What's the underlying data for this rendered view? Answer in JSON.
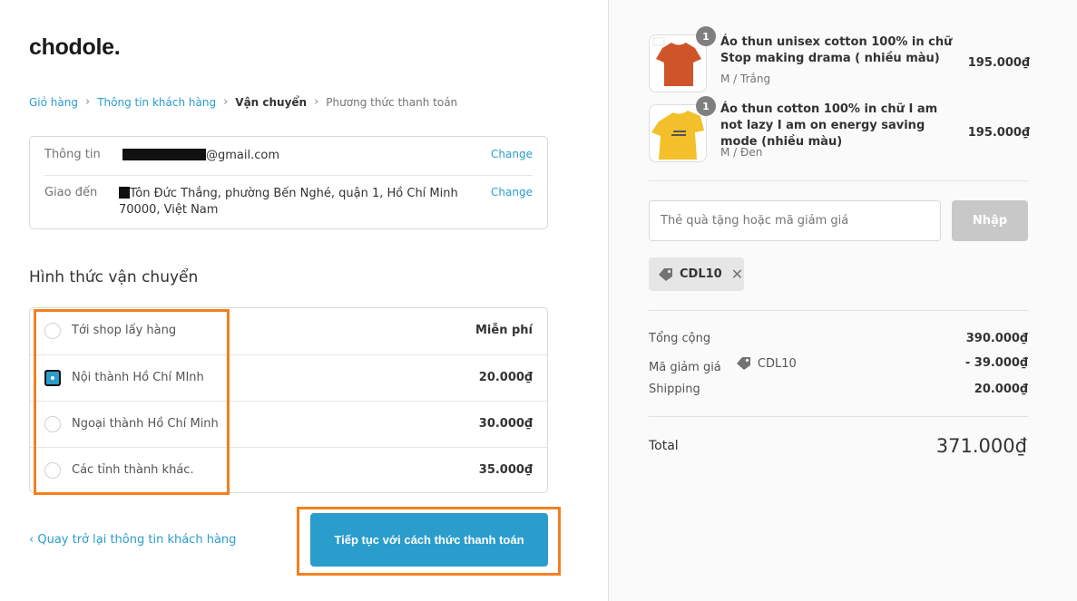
{
  "brand": "chodole.",
  "breadcrumb": {
    "cart": "Giỏ hàng",
    "customer_info": "Thông tin khách hàng",
    "shipping": "Vận chuyển",
    "payment": "Phương thức thanh toán"
  },
  "info": {
    "contact_label": "Thông tin",
    "contact_value": "@gmail.com",
    "ship_to_label": "Giao đến",
    "ship_to_value": "Tôn Đức Thắng, phường Bến Nghé, quận 1, Hồ Chí Minh 70000, Việt Nam",
    "change_label": "Change"
  },
  "shipping": {
    "title": "Hình thức vận chuyển",
    "options": [
      {
        "name": "Tới shop lấy hàng",
        "price": "Miễn phí",
        "selected": false
      },
      {
        "name": "Nội thành Hồ Chí MInh",
        "price": "20.000₫",
        "selected": true
      },
      {
        "name": "Ngoại thành Hồ Chí Minh",
        "price": "30.000₫",
        "selected": false
      },
      {
        "name": "Các tỉnh thành khác.",
        "price": "35.000₫",
        "selected": false
      }
    ]
  },
  "nav": {
    "back": "Quay trở lại thông tin khách hàng",
    "continue": "Tiếp tục với cách thức thanh toán"
  },
  "products": [
    {
      "quantity": "1",
      "name": "Áo thun unisex cotton 100% in chữ Stop making drama ( nhiều màu)",
      "variant": "M / Trắng",
      "price": "195.000₫",
      "color": "#d0542a"
    },
    {
      "quantity": "1",
      "name": "Áo thun cotton 100% in chữ I am not lazy I am on energy saving mode (nhiều màu)",
      "variant": "M / Đen",
      "price": "195.000₫",
      "color": "#f3c02b"
    }
  ],
  "discount": {
    "placeholder": "Thẻ quà tặng hoặc mã giảm giá",
    "apply": "Nhập",
    "applied_code": "CDL10"
  },
  "summary": {
    "subtotal_label": "Tổng cộng",
    "subtotal_value": "390.000₫",
    "discount_label": "Mã giảm giá",
    "discount_code": "CDL10",
    "discount_value": "- 39.000₫",
    "shipping_label": "Shipping",
    "shipping_value": "20.000₫",
    "total_label": "Total",
    "total_value": "371.000₫"
  }
}
